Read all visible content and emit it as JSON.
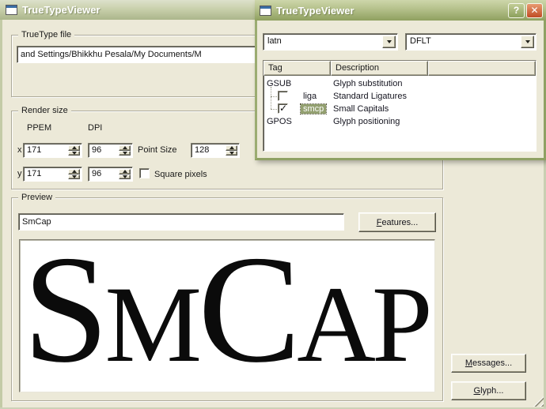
{
  "colors": {
    "window_face": "#ECE9D8",
    "active_title_top": "#CDD6AA",
    "active_title_bottom": "#8FA05F",
    "inactive_title_top": "#DDE1CB",
    "inactive_title_bottom": "#ABB68B",
    "dialog_border": "#8FA164",
    "close_button": "#C04C25",
    "help_button": "#8CA05C",
    "selection_highlight": "#93A070",
    "glyph_color": "#0B0B0B"
  },
  "icons": {
    "help": "?",
    "close": "✕",
    "check": "✓"
  },
  "main_window": {
    "title": "TrueTypeViewer",
    "file_group": {
      "label": "TrueType file",
      "path_value": "and Settings/Bhikkhu Pesala/My Documents/M"
    },
    "render_group": {
      "label": "Render size",
      "col_ppem": "PPEM",
      "col_dpi": "DPI",
      "row_x_label": "x",
      "row_y_label": "y",
      "x_ppem": "171",
      "x_dpi": "96",
      "y_ppem": "171",
      "y_dpi": "96",
      "point_size_label": "Point Size",
      "point_size_value": "128",
      "square_pixels_label": "Square pixels"
    },
    "preview_group": {
      "label": "Preview",
      "sample_text": "SmCap",
      "features_button": {
        "mnemonic": "F",
        "rest": "eatures..."
      },
      "rendered": {
        "seg1": "S",
        "seg2": "M",
        "seg3": "C",
        "seg4": "AP"
      }
    },
    "messages_button": {
      "mnemonic": "M",
      "rest": "essages..."
    },
    "glyph_button": {
      "mnemonic": "G",
      "rest": "lyph..."
    }
  },
  "dialog": {
    "title": "TrueTypeViewer",
    "script_select": "latn",
    "language_select": "DFLT",
    "feature_table": {
      "col_tag": "Tag",
      "col_description": "Description",
      "rows": [
        {
          "tag": "GSUB",
          "description": "Glyph substitution"
        },
        {
          "tag": "liga",
          "description": "Standard Ligatures",
          "checked": false,
          "selected": false
        },
        {
          "tag": "smcp",
          "description": "Small Capitals",
          "checked": true,
          "selected": true
        },
        {
          "tag": "GPOS",
          "description": "Glyph positioning"
        }
      ]
    }
  }
}
